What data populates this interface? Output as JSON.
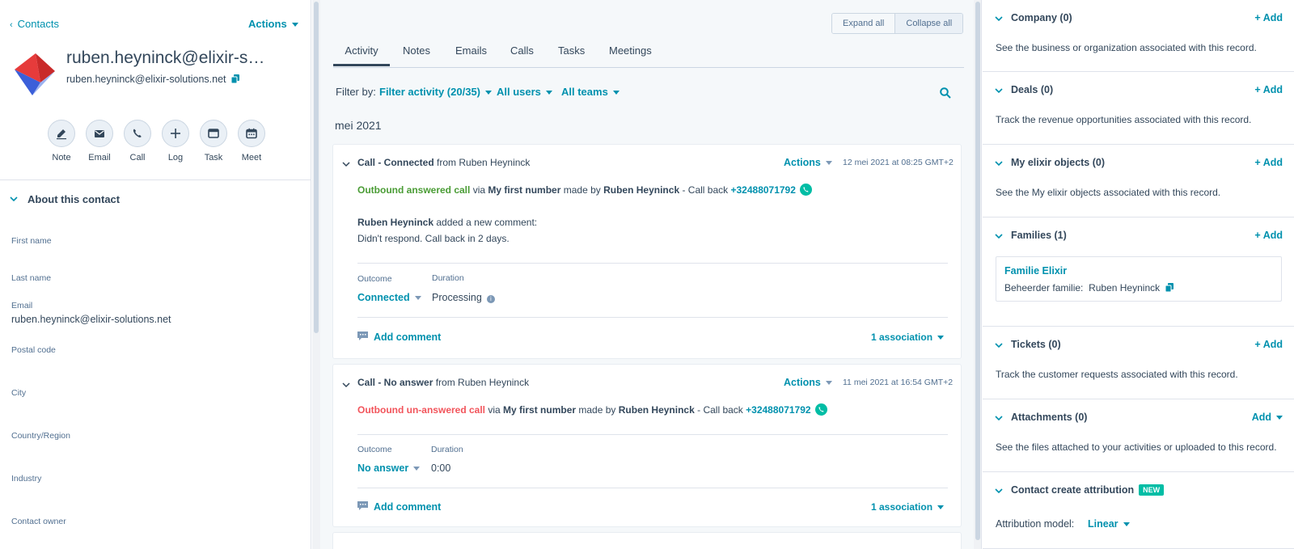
{
  "left": {
    "back_label": "Contacts",
    "actions_label": "Actions",
    "contact_name": "ruben.heyninck@elixir-s…",
    "contact_email": "ruben.heyninck@elixir-solutions.net",
    "quick_actions": [
      {
        "label": "Note",
        "icon": "edit-icon"
      },
      {
        "label": "Email",
        "icon": "email-icon"
      },
      {
        "label": "Call",
        "icon": "phone-icon"
      },
      {
        "label": "Log",
        "icon": "plus-icon"
      },
      {
        "label": "Task",
        "icon": "task-icon"
      },
      {
        "label": "Meet",
        "icon": "calendar-icon"
      }
    ],
    "about_title": "About this contact",
    "properties": [
      {
        "label": "First name",
        "value": ""
      },
      {
        "label": "Last name",
        "value": ""
      },
      {
        "label": "Email",
        "value": "ruben.heyninck@elixir-solutions.net"
      },
      {
        "label": "Postal code",
        "value": ""
      },
      {
        "label": "City",
        "value": ""
      },
      {
        "label": "Country/Region",
        "value": ""
      },
      {
        "label": "Industry",
        "value": ""
      },
      {
        "label": "Contact owner",
        "value": ""
      }
    ]
  },
  "middle": {
    "expand_all": "Expand all",
    "collapse_all": "Collapse all",
    "tabs": [
      "Activity",
      "Notes",
      "Emails",
      "Calls",
      "Tasks",
      "Meetings"
    ],
    "active_tab": "Activity",
    "filter_by": "Filter by:",
    "filter_activity": "Filter activity (20/35)",
    "all_users": "All users",
    "all_teams": "All teams",
    "month": "mei 2021",
    "cards": [
      {
        "title_bold": "Call - Connected",
        "title_rest": " from Ruben Heyninck",
        "actions": "Actions",
        "date": "12 mei 2021 at 08:25 GMT+2",
        "status": "Outbound answered call",
        "via": " via ",
        "number_name": "My first number",
        "made_by": " made by ",
        "caller": "Ruben Heyninck",
        "call_back": " - Call back ",
        "phone": "+32488071792",
        "comment_author": "Ruben Heyninck",
        "comment_action": " added a new comment:",
        "comment_text": "Didn't respond. Call back in 2 days.",
        "outcome_label": "Outcome",
        "outcome_value": "Connected",
        "duration_label": "Duration",
        "duration_value": "Processing",
        "add_comment": "Add comment",
        "association": "1 association"
      },
      {
        "title_bold": "Call - No answer",
        "title_rest": " from Ruben Heyninck",
        "actions": "Actions",
        "date": "11 mei 2021 at 16:54 GMT+2",
        "status": "Outbound un-answered call",
        "via": " via ",
        "number_name": "My first number",
        "made_by": " made by ",
        "caller": "Ruben Heyninck",
        "call_back": " - Call back ",
        "phone": "+32488071792",
        "outcome_label": "Outcome",
        "outcome_value": "No answer",
        "duration_label": "Duration",
        "duration_value": "0:00",
        "add_comment": "Add comment",
        "association": "1 association"
      }
    ]
  },
  "right": {
    "sections": [
      {
        "title": "Company (0)",
        "add": "+ Add",
        "desc": "See the business or organization associated with this record."
      },
      {
        "title": "Deals (0)",
        "add": "+ Add",
        "desc": "Track the revenue opportunities associated with this record."
      },
      {
        "title": "My elixir objects (0)",
        "add": "+ Add",
        "desc": "See the My elixir objects associated with this record."
      },
      {
        "title": "Families (1)",
        "add": "+ Add",
        "desc": ""
      },
      {
        "title": "Tickets (0)",
        "add": "+ Add",
        "desc": "Track the customer requests associated with this record."
      },
      {
        "title": "Attachments (0)",
        "add": "Add",
        "desc": "See the files attached to your activities or uploaded to this record."
      },
      {
        "title": "Contact create attribution",
        "add": "",
        "desc": ""
      }
    ],
    "family": {
      "name": "Familie Elixir",
      "field_label": "Beheerder familie:",
      "field_value": "Ruben Heyninck"
    },
    "new_badge": "NEW",
    "attribution_label": "Attribution model:",
    "attribution_value": "Linear"
  },
  "colors": {
    "link": "#0091ae",
    "text": "#33475b",
    "green": "#4a9c35",
    "red": "#f2545b",
    "teal": "#00bda5"
  }
}
